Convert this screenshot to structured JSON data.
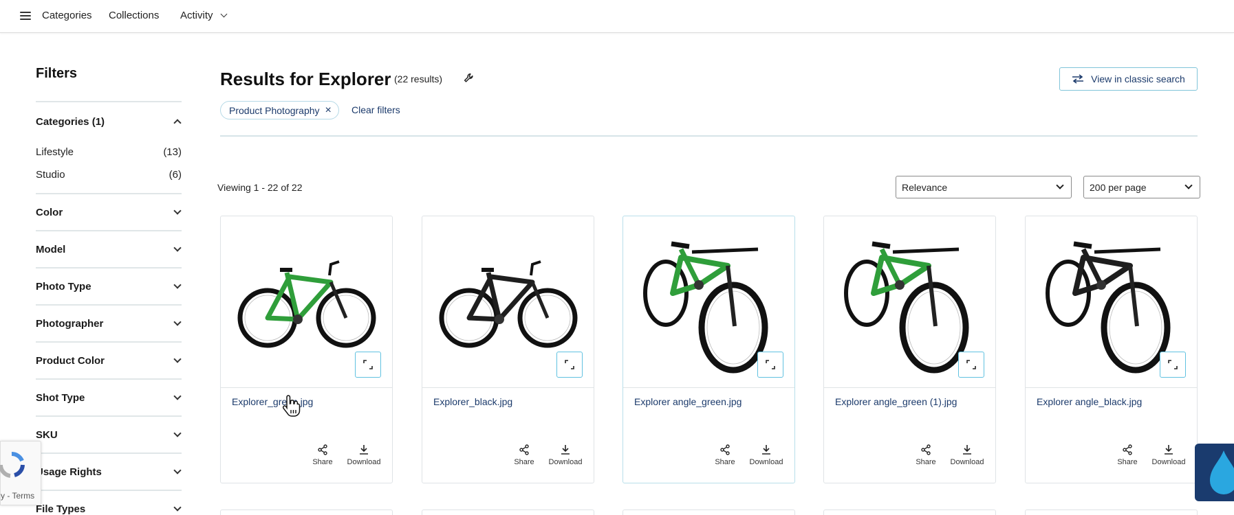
{
  "nav": {
    "categories": "Categories",
    "collections": "Collections",
    "activity": "Activity"
  },
  "sidebar": {
    "title": "Filters",
    "facets": [
      {
        "label": "Categories (1)",
        "open": true,
        "items": [
          {
            "label": "Lifestyle",
            "count": "(13)"
          },
          {
            "label": "Studio",
            "count": "(6)"
          }
        ]
      },
      {
        "label": "Color"
      },
      {
        "label": "Model"
      },
      {
        "label": "Photo Type"
      },
      {
        "label": "Photographer"
      },
      {
        "label": "Product Color"
      },
      {
        "label": "Shot Type"
      },
      {
        "label": "SKU"
      },
      {
        "label": "Usage Rights"
      },
      {
        "label": "File Types"
      }
    ]
  },
  "results": {
    "title": "Results for Explorer",
    "count": "(22 results)",
    "classic_button": "View in classic search",
    "chip_label": "Product Photography",
    "clear_filters": "Clear filters",
    "viewing": "Viewing 1 - 22 of 22",
    "sort_value": "Relevance",
    "per_page_value": "200 per page"
  },
  "cards": [
    {
      "filename": "Explorer_green.jpg",
      "color": "#2f9e3a",
      "variant": "side"
    },
    {
      "filename": "Explorer_black.jpg",
      "color": "#1e1e1e",
      "variant": "side"
    },
    {
      "filename": "Explorer angle_green.jpg",
      "color": "#2f9e3a",
      "variant": "angle"
    },
    {
      "filename": "Explorer angle_green (1).jpg",
      "color": "#2f9e3a",
      "variant": "angle"
    },
    {
      "filename": "Explorer angle_black.jpg",
      "color": "#1e1e1e",
      "variant": "angle"
    }
  ],
  "card_actions": {
    "share": "Share",
    "download": "Download"
  },
  "recaptcha": {
    "terms": "y - Terms"
  },
  "colors": {
    "link": "#1b3a6b",
    "accent_border": "#5fc1e0",
    "badge": "#1a3b6e"
  }
}
